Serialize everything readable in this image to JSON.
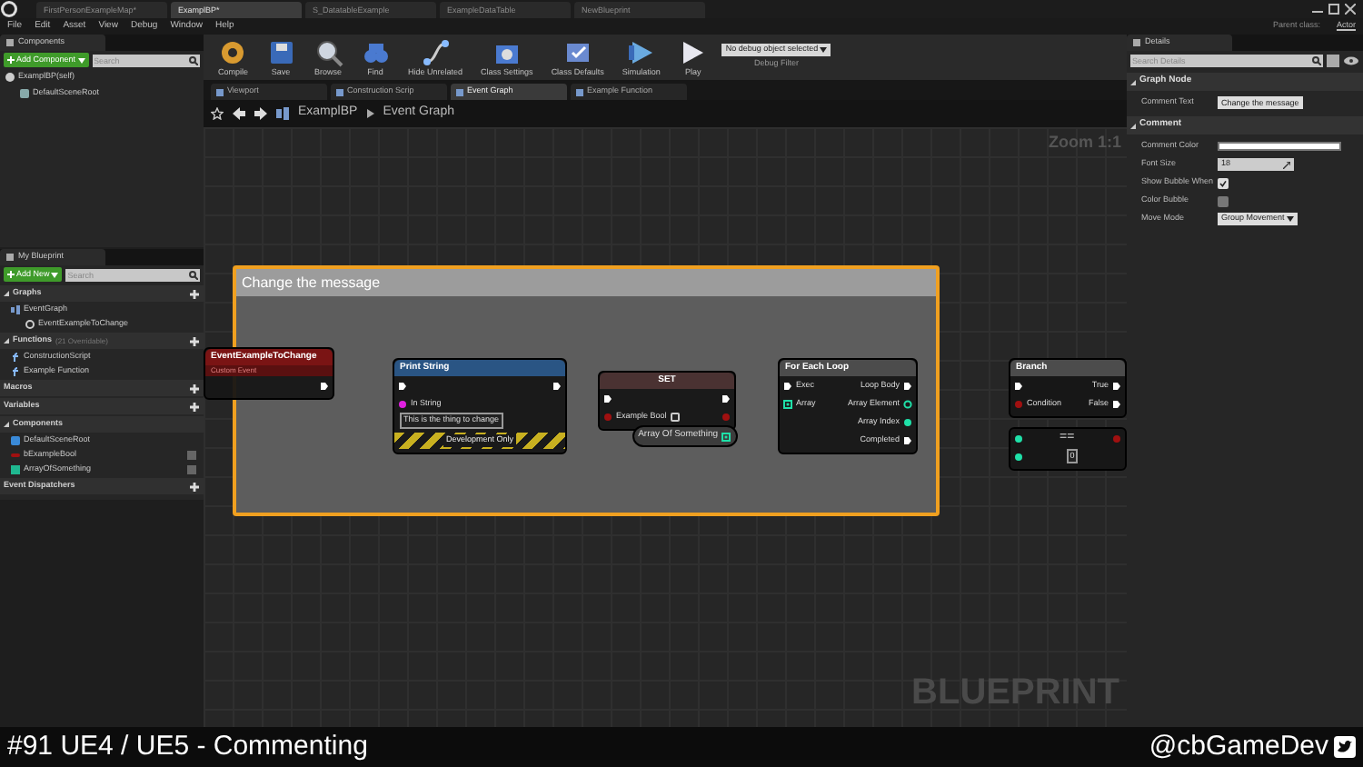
{
  "title_tabs": [
    {
      "label": "FirstPersonExampleMap*",
      "selected": false
    },
    {
      "label": "ExamplBP*",
      "selected": true
    },
    {
      "label": "S_DatatableExample",
      "selected": false
    },
    {
      "label": "ExampleDataTable",
      "selected": false
    },
    {
      "label": "NewBlueprint",
      "selected": false
    }
  ],
  "menu": [
    "File",
    "Edit",
    "Asset",
    "View",
    "Debug",
    "Window",
    "Help"
  ],
  "parent_class": {
    "label": "Parent class:",
    "value": "Actor"
  },
  "components_panel": {
    "title": "Components",
    "add_button": "Add Component",
    "search_placeholder": "Search",
    "items": [
      {
        "label": "ExamplBP(self)",
        "children": [
          {
            "label": "DefaultSceneRoot"
          }
        ]
      }
    ]
  },
  "my_blueprint": {
    "title": "My Blueprint",
    "add_button": "Add New",
    "search_placeholder": "Search",
    "sections": [
      {
        "label": "Graphs",
        "addable": true,
        "items": [
          {
            "label": "EventGraph",
            "kind": "graph",
            "children": [
              {
                "label": "EventExampleToChange",
                "kind": "event"
              }
            ]
          }
        ]
      },
      {
        "label": "Functions",
        "note": "(21 Overridable)",
        "addable": true,
        "items": [
          {
            "label": "ConstructionScript",
            "kind": "function"
          },
          {
            "label": "Example Function",
            "kind": "function"
          }
        ]
      },
      {
        "label": "Macros",
        "addable": true
      },
      {
        "label": "Variables",
        "addable": true
      },
      {
        "label": "Components",
        "addable": false,
        "items": [
          {
            "label": "DefaultSceneRoot",
            "kind": "component"
          },
          {
            "label": "bExampleBool",
            "kind": "bool"
          },
          {
            "label": "ArrayOfSomething",
            "kind": "array"
          }
        ]
      },
      {
        "label": "Event Dispatchers",
        "addable": true
      }
    ]
  },
  "toolbar": {
    "buttons": [
      {
        "label": "Compile",
        "kind": "compile"
      },
      {
        "label": "Save",
        "kind": "save"
      },
      {
        "label": "Browse",
        "kind": "browse"
      },
      {
        "label": "Find",
        "kind": "find"
      },
      {
        "label": "Hide Unrelated",
        "kind": "hide"
      },
      {
        "label": "Class Settings",
        "kind": "settings"
      },
      {
        "label": "Class Defaults",
        "kind": "defaults"
      },
      {
        "label": "Simulation",
        "kind": "simulation"
      },
      {
        "label": "Play",
        "kind": "play"
      }
    ],
    "debug_dropdown": {
      "value": "No debug object selected",
      "label": "Debug Filter"
    }
  },
  "editor_tabs": [
    {
      "label": "Viewport",
      "selected": false
    },
    {
      "label": "Construction Scrip",
      "selected": false
    },
    {
      "label": "Event Graph",
      "selected": true
    },
    {
      "label": "Example Function",
      "selected": false
    }
  ],
  "breadcrumb": [
    "ExamplBP",
    "Event Graph"
  ],
  "graph": {
    "zoom": "Zoom 1:1",
    "comment": "Change the message",
    "watermark": "BLUEPRINT",
    "nodes": [
      {
        "kind": "event",
        "title": "EventExampleToChange",
        "subtitle": "Custom Event",
        "outputs": [
          {
            "kind": "exec"
          }
        ]
      },
      {
        "kind": "function",
        "title": "Print String",
        "footer": "Development Only",
        "inputs": [
          {
            "kind": "exec"
          },
          {
            "kind": "string",
            "label": "In String",
            "value": "This is the thing to change"
          }
        ],
        "outputs": [
          {
            "kind": "exec"
          }
        ]
      },
      {
        "kind": "set",
        "title": "SET",
        "inputs": [
          {
            "kind": "exec"
          },
          {
            "kind": "bool",
            "label": "Example Bool",
            "checked": false
          }
        ],
        "outputs": [
          {
            "kind": "exec"
          },
          {
            "kind": "bool"
          }
        ]
      },
      {
        "kind": "getter",
        "title": "Array Of Something",
        "outputs": [
          {
            "kind": "array"
          }
        ]
      },
      {
        "kind": "loop",
        "title": "For Each Loop",
        "inputs": [
          {
            "kind": "exec",
            "label": "Exec"
          },
          {
            "kind": "array",
            "label": "Array"
          }
        ],
        "outputs": [
          {
            "kind": "exec",
            "label": "Loop Body"
          },
          {
            "kind": "wildcard",
            "label": "Array Element"
          },
          {
            "kind": "int",
            "label": "Array Index"
          },
          {
            "kind": "exec",
            "label": "Completed"
          }
        ]
      },
      {
        "kind": "branch",
        "title": "Branch",
        "inputs": [
          {
            "kind": "exec"
          },
          {
            "kind": "bool",
            "label": "Condition"
          }
        ],
        "outputs": [
          {
            "kind": "exec",
            "label": "True"
          },
          {
            "kind": "exec",
            "label": "False"
          }
        ]
      },
      {
        "kind": "compare",
        "title": "==",
        "inputs": [
          {
            "kind": "int"
          },
          {
            "kind": "int",
            "value": "0"
          }
        ],
        "outputs": [
          {
            "kind": "bool"
          }
        ]
      }
    ]
  },
  "details": {
    "title": "Details",
    "search_placeholder": "Search Details",
    "sections": [
      {
        "label": "Graph Node",
        "rows": [
          {
            "label": "Comment Text",
            "kind": "text",
            "value": "Change the message"
          }
        ]
      },
      {
        "label": "Comment",
        "rows": [
          {
            "label": "Comment Color",
            "kind": "color",
            "color": "#ffffff"
          },
          {
            "label": "Font Size",
            "kind": "number",
            "value": "18"
          },
          {
            "label": "Show Bubble When",
            "kind": "checkbox",
            "checked": true
          },
          {
            "label": "Color Bubble",
            "kind": "checkbox",
            "checked": false
          },
          {
            "label": "Move Mode",
            "kind": "dropdown",
            "value": "Group Movement"
          }
        ]
      }
    ]
  },
  "caption": {
    "title": "#91 UE4 / UE5 - Commenting",
    "handle": "@cbGameDev"
  }
}
